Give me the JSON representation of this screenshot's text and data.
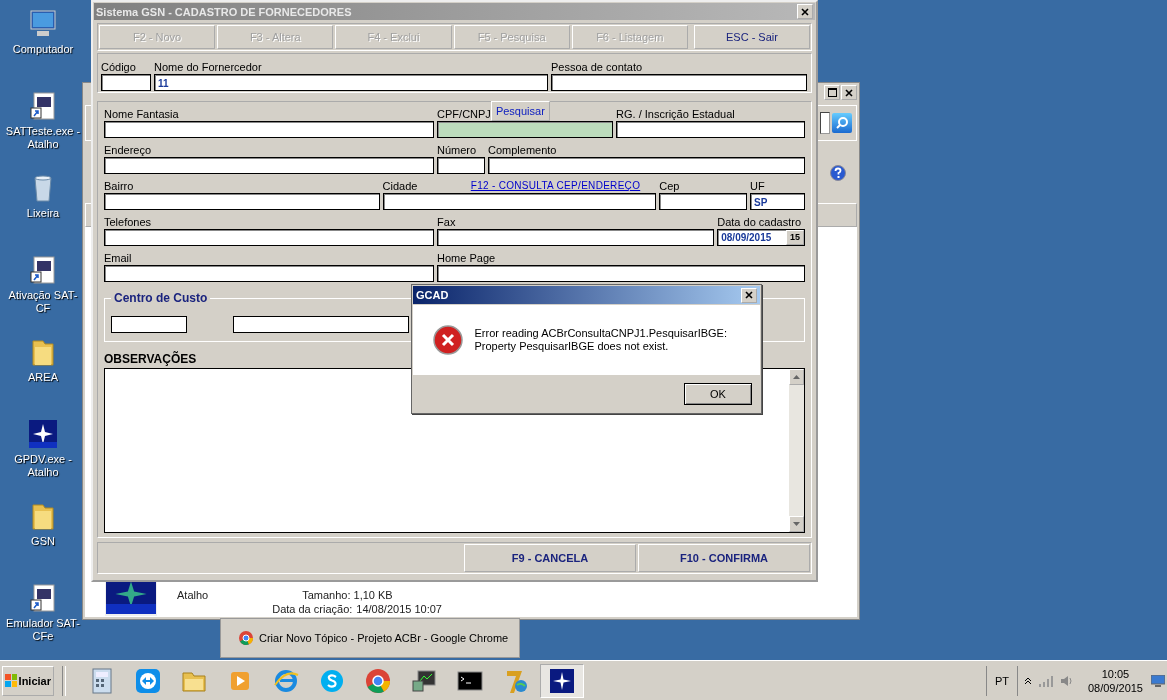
{
  "desktop_icons": [
    {
      "label": "Computador",
      "kind": "computer"
    },
    {
      "label": "SATTeste.exe - Atalho",
      "kind": "shortcut"
    },
    {
      "label": "Lixeira",
      "kind": "bin"
    },
    {
      "label": "Ativação SAT-CF",
      "kind": "shortcut"
    },
    {
      "label": "AREA",
      "kind": "folder"
    },
    {
      "label": "GPDV.exe - Atalho",
      "kind": "star"
    },
    {
      "label": "GSN",
      "kind": "folder"
    },
    {
      "label": "Emulador SAT-CFe",
      "kind": "shortcut"
    }
  ],
  "background_window": {
    "file_type": "Atalho",
    "file_size": "Tamanho: 1,10 KB",
    "created_label": "Data da criação:",
    "created_value": "14/08/2015 10:07"
  },
  "main_window": {
    "title": "Sistema GSN - CADASTRO DE FORNECEDORES",
    "toolbar": [
      {
        "label": "F2 - Novo",
        "disabled": true
      },
      {
        "label": "F3 - Altera",
        "disabled": true
      },
      {
        "label": "F4 - Exclui",
        "disabled": true
      },
      {
        "label": "F5 - Pesquisa",
        "disabled": true
      },
      {
        "label": "F6 - Listagem",
        "disabled": true
      },
      {
        "label": "ESC - Sair",
        "disabled": false
      }
    ],
    "header_fields": [
      {
        "label": "Código",
        "kind": "text"
      },
      {
        "label": "Nome do Fornercedor",
        "value": "11",
        "kind": "text"
      },
      {
        "label": "Pessoa de contato",
        "kind": "text"
      }
    ],
    "rows": [
      [
        {
          "label": "Nome Fantasia",
          "kind": "text"
        },
        {
          "label": "CPF/CNPJ",
          "kind": "search",
          "button": "Pesquisar"
        },
        {
          "label": "RG. / Inscrição Estadual",
          "kind": "text"
        }
      ],
      [
        {
          "label": "Endereço",
          "kind": "text"
        },
        {
          "label": "Número",
          "kind": "text"
        },
        {
          "label": "Complemento",
          "kind": "text"
        }
      ],
      [
        {
          "label": "Bairro",
          "kind": "text"
        },
        {
          "label": "Cidade",
          "kind": "text",
          "link": "F12 - CONSULTA CEP/ENDEREÇO"
        },
        {
          "label": "Cep",
          "kind": "text"
        },
        {
          "label": "UF",
          "value": "SP",
          "kind": "text"
        }
      ],
      [
        {
          "label": "Telefones",
          "kind": "text"
        },
        {
          "label": "Fax",
          "kind": "text"
        },
        {
          "label": "Data do cadastro",
          "value": "08/09/2015",
          "kind": "date",
          "button": "15"
        }
      ],
      [
        {
          "label": "Email",
          "kind": "text"
        },
        {
          "label": "Home Page",
          "kind": "text"
        }
      ]
    ],
    "cost_center": {
      "title": "Centro de Custo"
    },
    "observations": {
      "label": "OBSERVAÇÕES"
    },
    "footer_buttons": [
      "F9 - CANCELA",
      "F10 - CONFIRMA"
    ]
  },
  "dialog": {
    "title": "GCAD",
    "message": "Error reading ACBrConsultaCNPJ1.PesquisarIBGE: Property PesquisarIBGE does not exist.",
    "button": "OK"
  },
  "taskbar_preview": {
    "title": "Criar Novo Tópico - Projeto ACBr - Google Chrome"
  },
  "taskbar": {
    "start": "Iniciar",
    "apps": [
      {
        "kind": "calculator",
        "selected": false
      },
      {
        "kind": "remote",
        "selected": false
      },
      {
        "kind": "folder",
        "selected": false
      },
      {
        "kind": "player",
        "selected": false
      },
      {
        "kind": "browser",
        "selected": false
      },
      {
        "kind": "skype",
        "selected": false
      },
      {
        "kind": "chrome",
        "selected": false
      },
      {
        "kind": "monitor",
        "selected": false
      },
      {
        "kind": "terminal",
        "selected": false
      },
      {
        "kind": "seven",
        "selected": false
      },
      {
        "kind": "star",
        "selected": true
      }
    ],
    "language": "PT",
    "time": "10:05",
    "date": "08/09/2015"
  }
}
